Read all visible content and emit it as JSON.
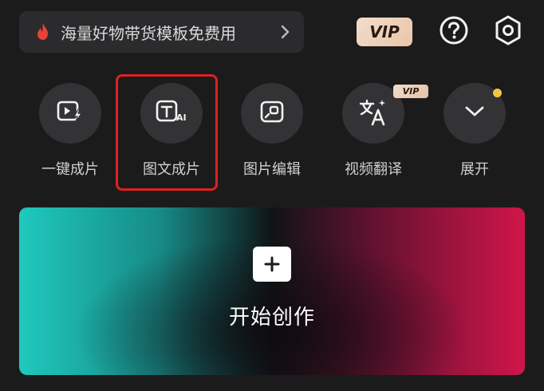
{
  "promo": {
    "text": "海量好物带货模板免费用",
    "icon": "flame-icon",
    "accent": "#e8423a"
  },
  "header": {
    "vip_label": "VIP",
    "help_icon": "question-circle-icon",
    "settings_icon": "hexagon-settings-icon"
  },
  "tools": [
    {
      "label": "一键成片",
      "icon": "video-lightning-icon"
    },
    {
      "label": "图文成片",
      "icon": "text-ai-icon",
      "highlighted": true
    },
    {
      "label": "图片编辑",
      "icon": "image-edit-icon"
    },
    {
      "label": "视频翻译",
      "icon": "translate-icon",
      "badge": "VIP"
    },
    {
      "label": "展开",
      "icon": "chevron-down-icon",
      "dot": true
    }
  ],
  "create": {
    "label": "开始创作",
    "icon": "plus-icon"
  },
  "colors": {
    "background": "#1b1b1c",
    "highlight": "#e0201f",
    "vip_gold": "#f3dccb",
    "dot": "#f5c542"
  }
}
